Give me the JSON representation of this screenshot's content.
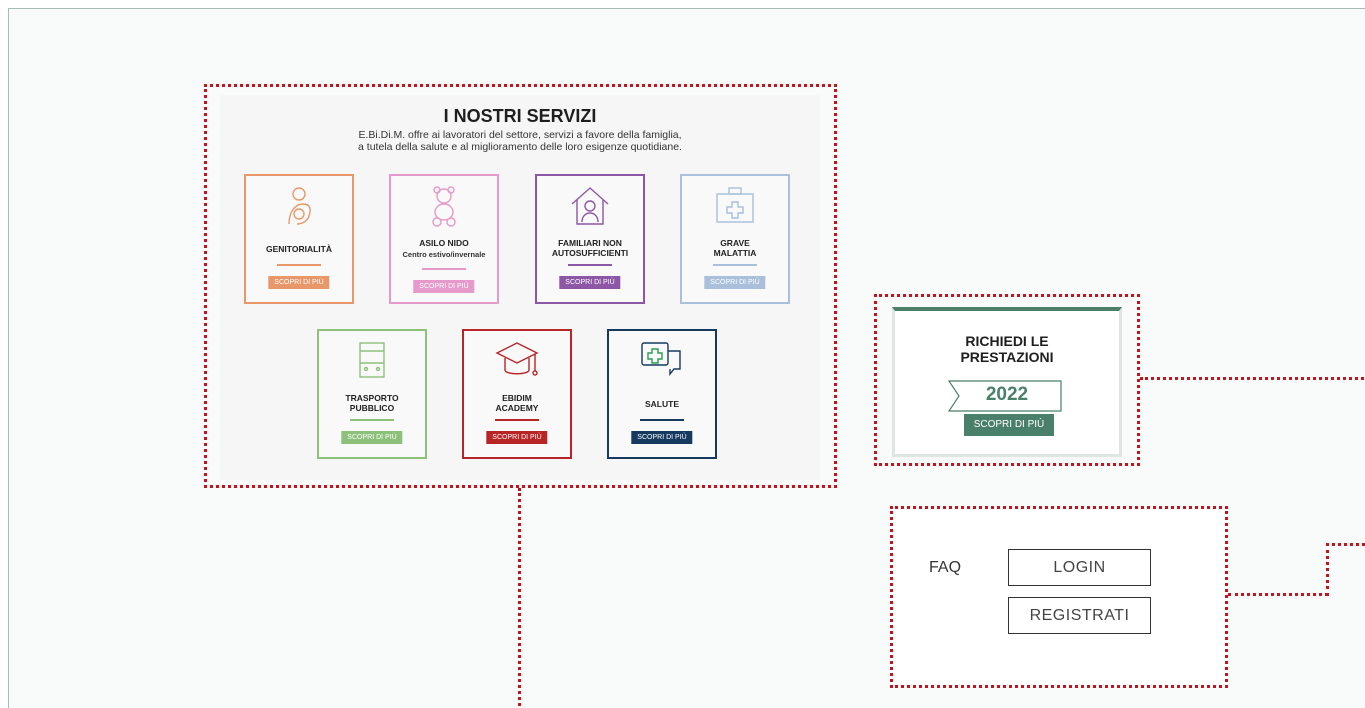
{
  "services": {
    "title": "I NOSTRI SERVIZI",
    "subtitle_line1": "E.Bi.Di.M. offre ai lavoratori del settore, servizi a favore della famiglia,",
    "subtitle_line2": "a tutela della salute e al miglioramento delle loro esigenze quotidiane.",
    "cards": [
      {
        "label": "GENITORIALITÀ",
        "sub": "",
        "button": "SCOPRI DI PIÙ",
        "color": "#e8976a",
        "icon": "mother-child-icon"
      },
      {
        "label": "ASILO NIDO",
        "sub": "Centro estivo/invernale",
        "button": "SCOPRI DI PIÙ",
        "color": "#e59acb",
        "icon": "teddy-bear-icon"
      },
      {
        "label": "FAMILIARI NON AUTOSUFFICIENTI",
        "sub": "",
        "button": "SCOPRI DI PIÙ",
        "color": "#8d57a6",
        "icon": "house-person-icon"
      },
      {
        "label": "GRAVE MALATTIA",
        "sub": "",
        "button": "SCOPRI DI PIÙ",
        "color": "#a9bfdc",
        "icon": "medical-kit-icon"
      },
      {
        "label": "TRASPORTO PUBBLICO",
        "sub": "",
        "button": "SCOPRI DI PIÙ",
        "color": "#8dc17b",
        "icon": "bus-icon"
      },
      {
        "label": "EBIDIM ACADEMY",
        "sub": "",
        "button": "SCOPRI DI PIÙ",
        "color": "#b82527",
        "icon": "graduation-cap-icon"
      },
      {
        "label": "SALUTE",
        "sub": "",
        "button": "SCOPRI DI PIÙ",
        "color": "#163a5f",
        "icon": "health-chat-icon"
      }
    ]
  },
  "richiedi": {
    "title_line1": "RICHIEDI LE",
    "title_line2": "PRESTAZIONI",
    "year": "2022",
    "button": "SCOPRI DI PIÙ",
    "accent": "#4a8069"
  },
  "auth": {
    "faq": "FAQ",
    "login": "LOGIN",
    "register": "REGISTRATI"
  },
  "annotation_color": "#c5131b"
}
